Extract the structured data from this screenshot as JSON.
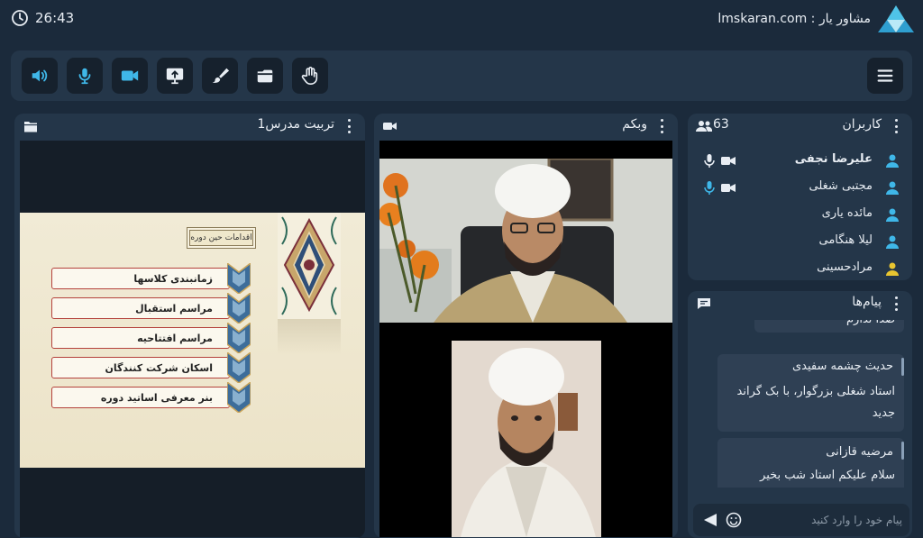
{
  "topbar": {
    "time": "26:43",
    "brand": "lmskaran.com : مشاور یار"
  },
  "toolbar": {
    "buttons": [
      "menu-icon",
      "hand-raise-icon",
      "folder-icon",
      "brush-icon",
      "screen-share-icon",
      "camera-icon",
      "microphone-icon",
      "speaker-icon"
    ],
    "colors": {
      "active_icon": "#3fb7e8",
      "inactive_icon": "#e8edf3",
      "button_bg": "#16212d"
    }
  },
  "slides_panel": {
    "title": "تربیت مدرس1",
    "slide": {
      "heading": "اقدامات حین دوره",
      "items": [
        "زمانبندی کلاسها",
        "مراسم استقبال",
        "مراسم افتتاحیه",
        "اسکان شرکت کنندگان",
        "بنر معرفی اساتید دوره"
      ]
    }
  },
  "webcam_panel": {
    "title": "وبکم"
  },
  "users_panel": {
    "title": "کاربران",
    "count": "63",
    "users": [
      {
        "name": "علیرضا نجفی",
        "icon_color": "#3fb7e8",
        "mic": "white",
        "cam": true,
        "bold": true
      },
      {
        "name": "مجتبی شغلی",
        "icon_color": "#3fb7e8",
        "mic": "blue",
        "cam": true,
        "bold": false
      },
      {
        "name": "مائده یاری",
        "icon_color": "#3fb7e8",
        "mic": "",
        "cam": false,
        "bold": false
      },
      {
        "name": "لیلا هنگامی",
        "icon_color": "#3fb7e8",
        "mic": "",
        "cam": false,
        "bold": false
      },
      {
        "name": "مرادحسینی",
        "icon_color": "#e8c530",
        "mic": "",
        "cam": false,
        "bold": false
      }
    ]
  },
  "chat_panel": {
    "title": "پیام‌ها",
    "messages": [
      {
        "name": "",
        "body": "صدا ندارم"
      },
      {
        "name": "حدیث چشمه سفیدی",
        "body": "استاد شغلی بزرگوار، با بک گراند جدید"
      },
      {
        "name": "مرضیه قازانی",
        "body": "سلام علیکم استاد شب بخیر"
      }
    ],
    "input_placeholder": "پیام خود را وارد کنید"
  }
}
